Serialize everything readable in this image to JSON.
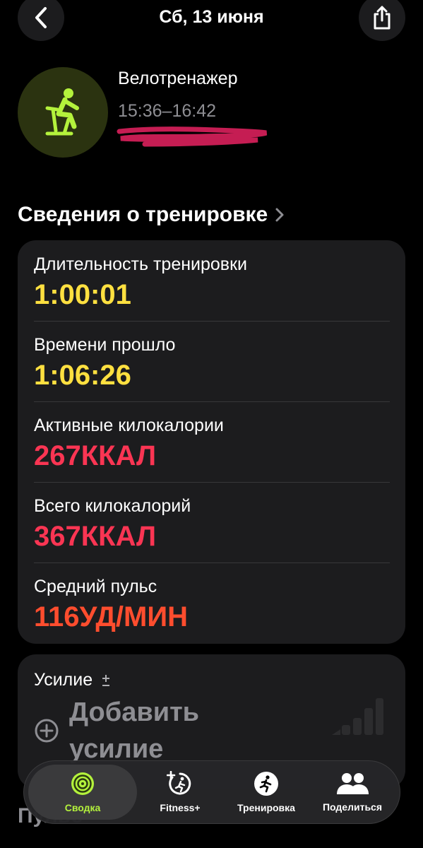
{
  "nav": {
    "title": "Сб, 13 июня"
  },
  "workout": {
    "name": "Велотренажер",
    "time_range": "15:36–16:42",
    "accent_color": "#b4f23c"
  },
  "details": {
    "header": "Сведения о тренировке",
    "rows": [
      {
        "label": "Длительность тренировки",
        "value": "1:00:01"
      },
      {
        "label": "Времени прошло",
        "value": "1:06:26"
      },
      {
        "label": "Активные килокалории",
        "value": "267ККАЛ"
      },
      {
        "label": "Всего килокалорий",
        "value": "367ККАЛ"
      },
      {
        "label": "Средний пульс",
        "value": "116УД/МИН"
      }
    ]
  },
  "effort": {
    "label": "Усилие",
    "add_label": "Добавить усилие"
  },
  "partial_section": "Пульс",
  "tabs": [
    {
      "label": "Сводка",
      "icon": "activity-rings-icon",
      "active": true
    },
    {
      "label": "Fitness+",
      "icon": "fitness-plus-icon",
      "active": false
    },
    {
      "label": "Тренировка",
      "icon": "running-figure-icon",
      "active": false
    },
    {
      "label": "Поделиться",
      "icon": "people-icon",
      "active": false
    }
  ]
}
